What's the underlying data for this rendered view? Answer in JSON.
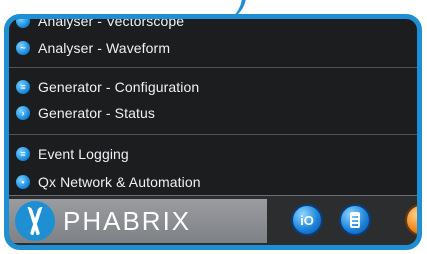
{
  "menu": {
    "items": [
      {
        "label": "Analyser - Vectorscope",
        "icon": "vectorscope-icon"
      },
      {
        "label": "Analyser - Waveform",
        "icon": "waveform-icon"
      },
      {
        "label": "Generator - Configuration",
        "icon": "generator-configuration-icon"
      },
      {
        "label": "Generator - Status",
        "icon": "generator-status-icon"
      },
      {
        "label": "Event Logging",
        "icon": "event-logging-icon"
      },
      {
        "label": "Qx Network & Automation",
        "icon": "network-automation-icon"
      }
    ]
  },
  "brand": {
    "name": "PHABRIX"
  },
  "toolbar": {
    "io_label": "iO",
    "buttons": [
      "io-icon",
      "panel-icon",
      "partial-orange-icon"
    ]
  },
  "colors": {
    "accent": "#1e8fd2",
    "menu_background": "#1c1d1e",
    "brand_background": "#8e9094"
  }
}
